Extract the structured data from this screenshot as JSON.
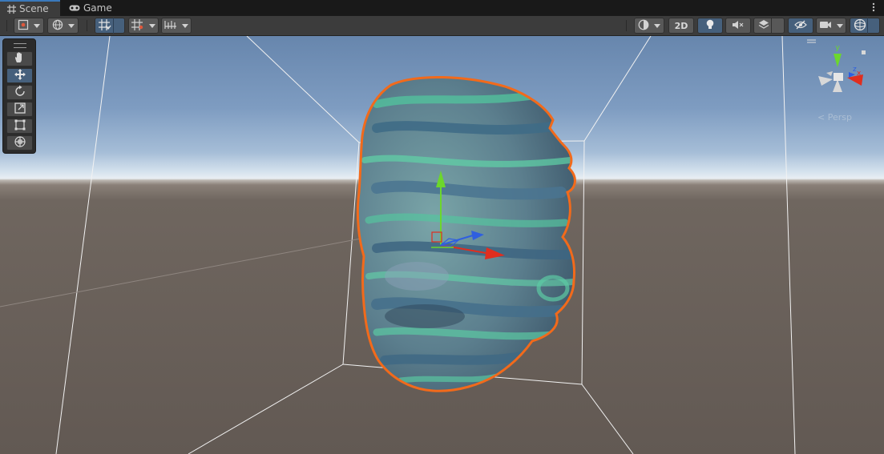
{
  "tabs": [
    {
      "label": "Scene",
      "icon": "grid-icon",
      "active": true
    },
    {
      "label": "Game",
      "icon": "gamepad-icon",
      "active": false
    }
  ],
  "toolbar": {
    "draw_mode_icon": "draw-mode-icon",
    "global_local_icon": "globe-icon",
    "grid_snap_icon": "grid-snap-icon",
    "snap_increment_icon": "snap-increment-icon",
    "grid_visibility_icon": "ruler-icon",
    "shading_icon": "shading-sphere-icon",
    "mode_2d_label": "2D",
    "lighting_icon": "lightbulb-icon",
    "audio_icon": "audio-mute-icon",
    "effects_icon": "layers-icon",
    "visibility_icon": "hidden-eye-icon",
    "camera_icon": "camera-icon",
    "gizmos_icon": "gizmo-sphere-icon",
    "colors": {
      "active": "#46607c",
      "button": "#585858"
    }
  },
  "tools": [
    {
      "name": "hand-tool",
      "icon": "hand-icon",
      "selected": false
    },
    {
      "name": "move-tool",
      "icon": "move-arrows-icon",
      "selected": true
    },
    {
      "name": "rotate-tool",
      "icon": "rotate-icon",
      "selected": false
    },
    {
      "name": "scale-tool",
      "icon": "scale-icon",
      "selected": false
    },
    {
      "name": "rect-tool",
      "icon": "rect-transform-icon",
      "selected": false
    },
    {
      "name": "transform-tool",
      "icon": "transform-icon",
      "selected": false
    }
  ],
  "scene": {
    "selected_object": "head-mesh",
    "selection_outline_color": "#f26a1b",
    "axis_colors": {
      "x": "#e02e1f",
      "y": "#6cd72c",
      "z": "#2f5fe0"
    }
  },
  "gizmo": {
    "axis_labels": {
      "x": "x",
      "y": "y",
      "z": "z"
    },
    "projection_label": "< Persp"
  }
}
